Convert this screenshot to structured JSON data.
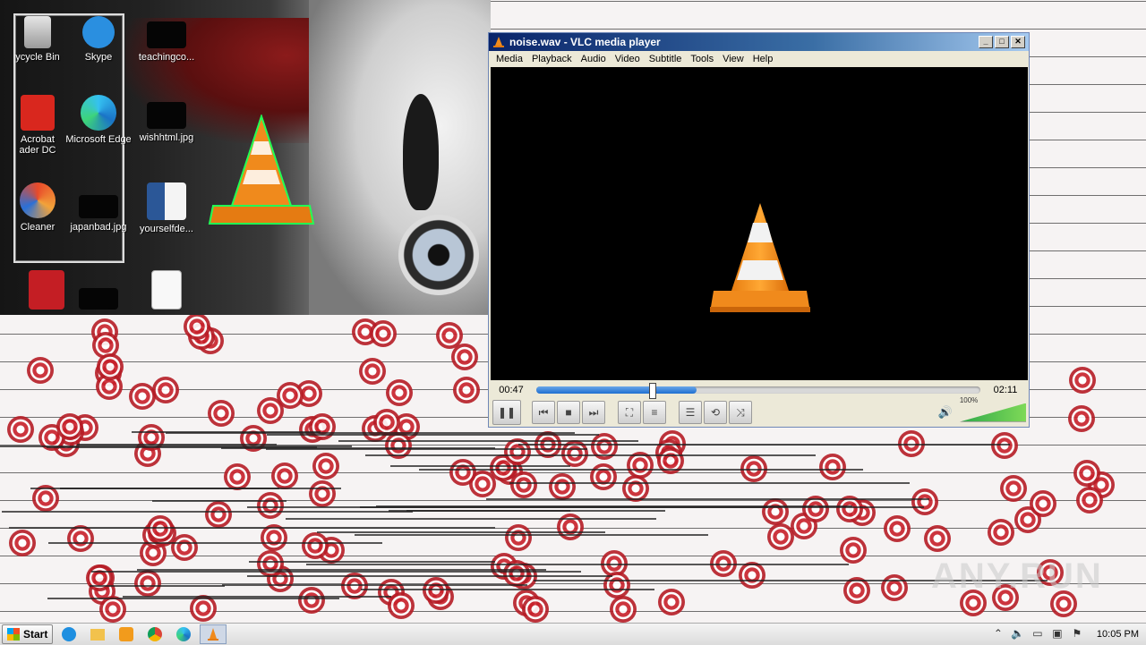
{
  "desktop": {
    "icons": [
      {
        "label": "ycycle Bin",
        "icon": "recycle-bin-icon"
      },
      {
        "label": "Skype",
        "icon": "skype-icon"
      },
      {
        "label": "teachingco...",
        "icon": "image-file-icon"
      },
      {
        "label": "Acrobat\nader DC",
        "icon": "acrobat-icon"
      },
      {
        "label": "Microsoft Edge",
        "icon": "edge-icon"
      },
      {
        "label": "wishhtml.jpg",
        "icon": "image-file-icon"
      },
      {
        "label": "Cleaner",
        "icon": "ccleaner-icon"
      },
      {
        "label": "japanbad.jpg",
        "icon": "image-file-icon"
      },
      {
        "label": "yourselfde...",
        "icon": "word-doc-icon"
      }
    ],
    "watermark": "ANY.RUN"
  },
  "vlc": {
    "title": "noise.wav - VLC media player",
    "menu": [
      "Media",
      "Playback",
      "Audio",
      "Video",
      "Subtitle",
      "Tools",
      "View",
      "Help"
    ],
    "elapsed": "00:47",
    "total": "02:11",
    "progress_fraction": 0.36,
    "volume": "100%",
    "volume_fraction": 1.0,
    "colors": {
      "cone_orange": "#f08a1c",
      "seek_blue": "#1e6fd0",
      "volume_green": "#2fa84a"
    }
  },
  "taskbar": {
    "start_label": "Start",
    "apps": [
      "ie-icon",
      "explorer-icon",
      "media-player-icon",
      "chrome-icon",
      "edge-icon",
      "vlc-icon"
    ],
    "clock": "10:05 PM"
  }
}
